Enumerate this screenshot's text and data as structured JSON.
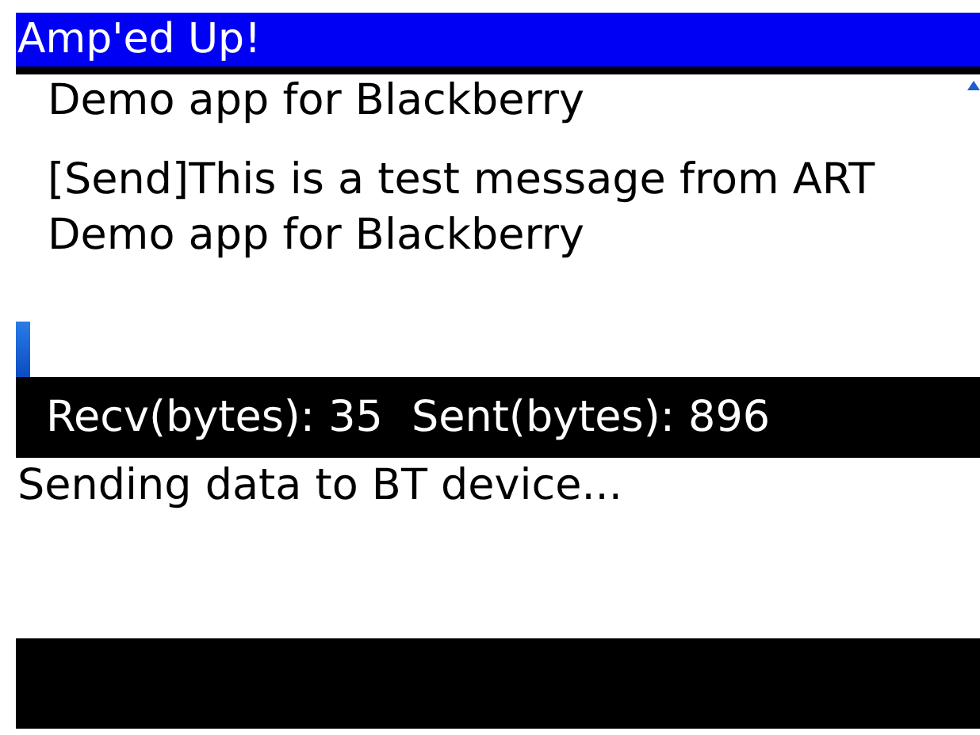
{
  "window": {
    "title": "Amp'ed Up!"
  },
  "log": {
    "clipped_line": "Demo app for Blackberry",
    "message": "[Send]This is a test message from ART Demo app for Blackberry"
  },
  "counters": {
    "recv": "Recv(bytes): 35",
    "sent": "Sent(bytes): 896"
  },
  "status": "Sending data to BT device..."
}
